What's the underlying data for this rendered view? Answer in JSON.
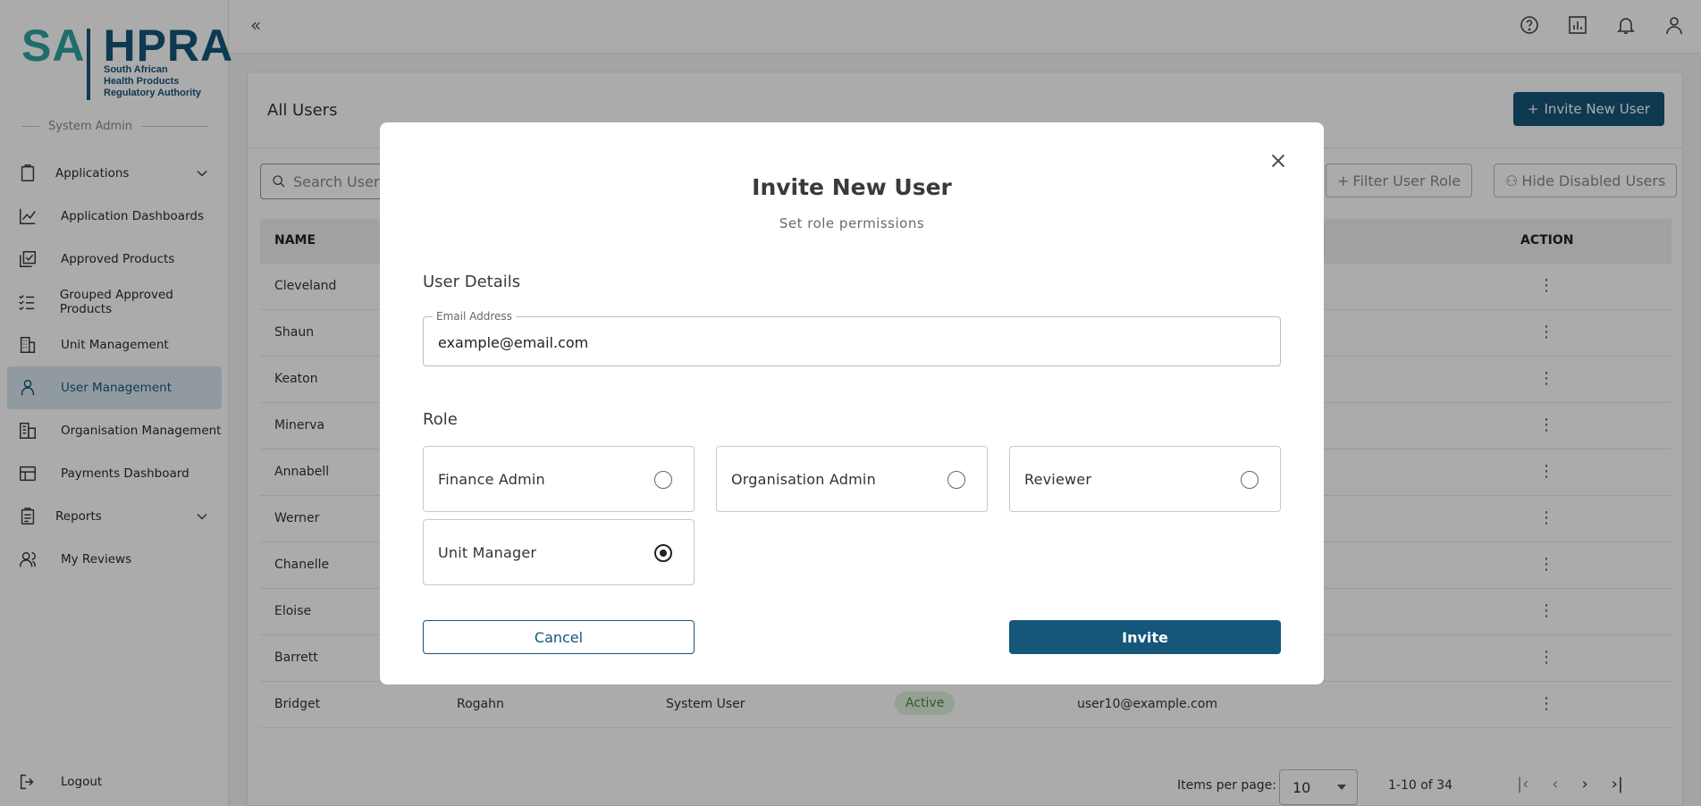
{
  "brand": {
    "logo_sa": "SA",
    "logo_hpra": "HPRA",
    "logo_line1": "South African",
    "logo_line2": "Health Products",
    "logo_line3": "Regulatory Authority"
  },
  "sidebar": {
    "section_label": "System Admin",
    "items": [
      {
        "label": "Applications",
        "icon": "clipboard-icon"
      },
      {
        "label": "Application Dashboards",
        "icon": "line-chart-icon"
      },
      {
        "label": "Approved Products",
        "icon": "checkbox-stack-icon"
      },
      {
        "label": "Grouped Approved Products",
        "icon": "checklist-icon"
      },
      {
        "label": "Unit Management",
        "icon": "building-icon"
      },
      {
        "label": "User Management",
        "icon": "person-icon"
      },
      {
        "label": "Organisation Management",
        "icon": "buildings-icon"
      },
      {
        "label": "Payments Dashboard",
        "icon": "dashboard-icon"
      },
      {
        "label": "Reports",
        "icon": "report-icon"
      },
      {
        "label": "My Reviews",
        "icon": "people-icon"
      }
    ],
    "logout_label": "Logout"
  },
  "topbar": {
    "collapse_glyph": "«",
    "icons": [
      "help-icon",
      "report-chart-icon",
      "bell-icon",
      "account-icon"
    ]
  },
  "main": {
    "title": "All Users",
    "invite_button": "Invite New User",
    "search_placeholder": "Search User",
    "filter_role": "Filter User Role",
    "hide_disabled": "Hide Disabled Users",
    "columns": {
      "name": "NAME",
      "action": "ACTION"
    },
    "rows": [
      {
        "name": "Cleveland"
      },
      {
        "name": "Shaun"
      },
      {
        "name": "Keaton"
      },
      {
        "name": "Minerva"
      },
      {
        "name": "Annabell"
      },
      {
        "name": "Werner"
      },
      {
        "name": "Chanelle"
      },
      {
        "name": "Eloise"
      },
      {
        "name": "Barrett"
      },
      {
        "name": "Bridget",
        "surname": "Rogahn",
        "type": "System User",
        "status": "Active",
        "email": "user10@example.com"
      }
    ],
    "dots": "⋮",
    "pager": {
      "items_label": "Items per page:",
      "per_page": "10",
      "range": "1-10 of 34"
    }
  },
  "modal": {
    "title": "Invite New User",
    "subtitle": "Set role permissions",
    "details_heading": "User Details",
    "email_label": "Email Address",
    "email_value": "example@email.com",
    "role_heading": "Role",
    "roles": [
      {
        "label": "Finance Admin",
        "selected": false
      },
      {
        "label": "Organisation Admin",
        "selected": false
      },
      {
        "label": "Reviewer",
        "selected": false
      },
      {
        "label": "Unit Manager",
        "selected": true
      }
    ],
    "cancel": "Cancel",
    "invite": "Invite"
  },
  "colors": {
    "primary": "#15567a",
    "logo_teal": "#2fa3a0",
    "active_nav_bg": "#d8e8ee",
    "status_active_bg": "#dff1df"
  }
}
